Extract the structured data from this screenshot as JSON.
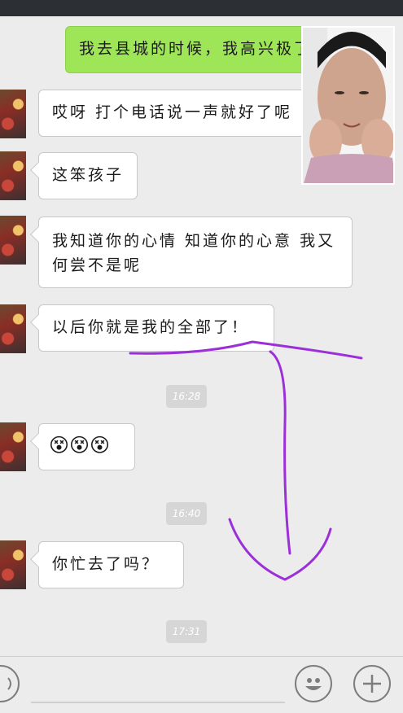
{
  "messages": [
    {
      "sender": "me",
      "text": "我去县城的时候，我高兴极了"
    },
    {
      "sender": "other",
      "text": "哎呀 打个电话说一声就好了呢"
    },
    {
      "sender": "other",
      "text": "这笨孩子"
    },
    {
      "sender": "other",
      "text": "我知道你的心情 知道你的心意 我又何尝不是呢"
    },
    {
      "sender": "other",
      "text": "以后你就是我的全部了！"
    },
    {
      "sender": "other",
      "text": "😵😵😵",
      "emoji": "dizzy-face-emoji"
    },
    {
      "sender": "other",
      "text": "你忙去了吗？"
    }
  ],
  "timestamps": [
    "16:28",
    "16:40",
    "17:31"
  ],
  "annotation": {
    "color": "#9b30d9",
    "shapes": [
      "underline-stroke",
      "down-arrow"
    ]
  },
  "colors": {
    "background": "#ececec",
    "my_bubble": "#9ee558",
    "other_bubble": "#ffffff",
    "status_bar": "#2c2f33"
  },
  "icons": {
    "voice": "voice-icon",
    "emoji": "emoji-icon",
    "add": "add-icon"
  }
}
